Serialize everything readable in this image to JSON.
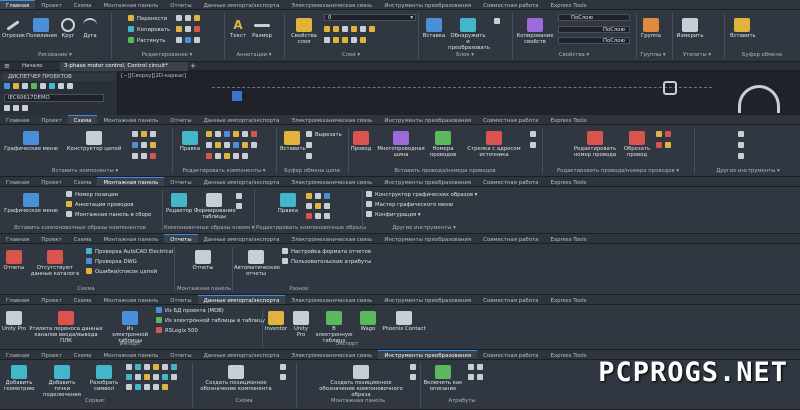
{
  "tabs_main": [
    "Главная",
    "Проект",
    "Схема",
    "Монтажная панель",
    "Отчеты",
    "Данные импорта/экспорта",
    "Электромеханическая связь",
    "Инструменты преобразования",
    "Совместная работа",
    "Express Tools"
  ],
  "top_ribbon": {
    "draw": [
      "Отрезок",
      "Полилиния",
      "Круг",
      "Дуга"
    ],
    "modify": [
      "Перенести",
      "Копировать",
      "Растянуть"
    ],
    "annot": [
      "Текст",
      "Размер"
    ],
    "layers": [
      "Свойства слоя"
    ],
    "block": [
      "Вставка",
      "Обнаружить и преобразовать"
    ],
    "props": [
      "Копирование свойств"
    ],
    "groups": [
      "Группа"
    ],
    "utils": [
      "Измерить"
    ],
    "clipboard": [
      "Вставить"
    ],
    "layer_value": "0",
    "prop_values": [
      "ПоСлою",
      "ПоСлою",
      "ПоСлою"
    ],
    "groups_labels": [
      "Рисование ▾",
      "Редактирование ▾",
      "Аннотации ▾",
      "Слои ▾",
      "Блок ▾",
      "Свойства ▾",
      "Группы ▾",
      "Утилиты ▾",
      "Буфер обмена"
    ]
  },
  "doc": {
    "home": "Начало",
    "file": "3-phase motor control, Control circuit*",
    "pm_title": "ДИСПЕТЧЕР ПРОЕКТОВ",
    "project": "IEC60617DEMO",
    "viewport": "[−][Сверху][2D-каркас]"
  },
  "r1": {
    "active": "Схема",
    "buttons": [
      "Графические меню",
      "Конструктор цепей",
      "Правка",
      "Вставить",
      "Вырезать",
      "Провод",
      "Многопроводная шина",
      "Номера проводов",
      "Стрелка с адресом источника",
      "Редактировать номер провода",
      "Обрезать провод"
    ],
    "groups": [
      "Вставить компоненты ▾",
      "Редактировать компоненты ▾",
      "Буфер обмена цепи",
      "Вставить провода/номера проводов",
      "Редактировать провода/номера проводов ▾",
      "Другие инструменты ▾"
    ]
  },
  "r2": {
    "active": "Монтажная панель",
    "buttons": [
      "Графическое меню",
      "Номер позиции",
      "Аннотация проводов",
      "Монтажная панель в сборе",
      "Редактор",
      "Формирование таблицы",
      "Правка",
      "Конструктор графических образов ▾",
      "Мастер графического меню",
      "Конфигурация ▾"
    ],
    "groups": [
      "Вставить компоновочные образы компонентов",
      "Компоновочные образы клемм ▾",
      "Редактировать компоновочные образы",
      "Другие инструменты ▾"
    ]
  },
  "r3": {
    "active": "Отчеты",
    "buttons": [
      "Отчеты",
      "Отсутствуют данные каталога",
      "Проверка AutoCAD Electrical",
      "Проверка DWG",
      "Ошибки/список цепей",
      "Отчеты",
      "Автоматические отчеты",
      "Настройка формата отчетов",
      "Пользовательские атрибуты"
    ],
    "groups": [
      "Схема",
      "Монтажная панель",
      "Разное"
    ]
  },
  "r4": {
    "active": "Данные импорта/экспорта",
    "buttons": [
      "Unity Pro",
      "Утилита переноса данных каналов ввода/вывода ПЛК",
      "Из электронной таблицы",
      "Из БД проекта (MDB)",
      "Из электронной таблицы в таблицу",
      "RSLogix 500",
      "Inventor",
      "Unity Pro",
      "В электронную таблицу",
      "Wago",
      "Phoenix Contact"
    ],
    "groups": [
      "Импорт",
      "Экспорт"
    ]
  },
  "r5": {
    "active": "Инструменты преобразования",
    "buttons": [
      "Добавить геометрию",
      "Добавить точки подключения",
      "Разобрать символ",
      "Создать позиционное обозначение компонента",
      "Создать позиционное обозначение компоновочного образа",
      "Включить как описание"
    ],
    "groups": [
      "Сервис",
      "Схема",
      "Монтажная панель",
      "Атрибуты"
    ]
  },
  "watermark": "PCPROGS.NET"
}
